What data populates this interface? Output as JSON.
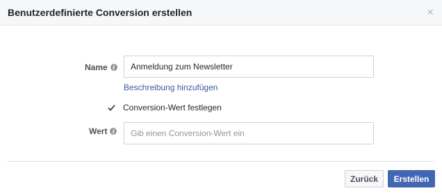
{
  "dialog": {
    "title": "Benutzerdefinierte Conversion erstellen",
    "close_symbol": "×"
  },
  "form": {
    "name_label": "Name",
    "name_value": "Anmeldung zum Newsletter",
    "description_link": "Beschreibung hinzufügen",
    "conversion_value_checkbox_label": "Conversion-Wert festlegen",
    "conversion_value_checked": true,
    "value_label": "Wert",
    "value_placeholder": "Gib einen Conversion-Wert ein"
  },
  "footer": {
    "back_label": "Zurück",
    "create_label": "Erstellen"
  },
  "icons": {
    "info": "info-icon",
    "close": "close-icon",
    "check": "checkmark-icon"
  },
  "colors": {
    "primary_button": "#4267b2",
    "link": "#365899",
    "header_bg": "#f6f7f9"
  }
}
